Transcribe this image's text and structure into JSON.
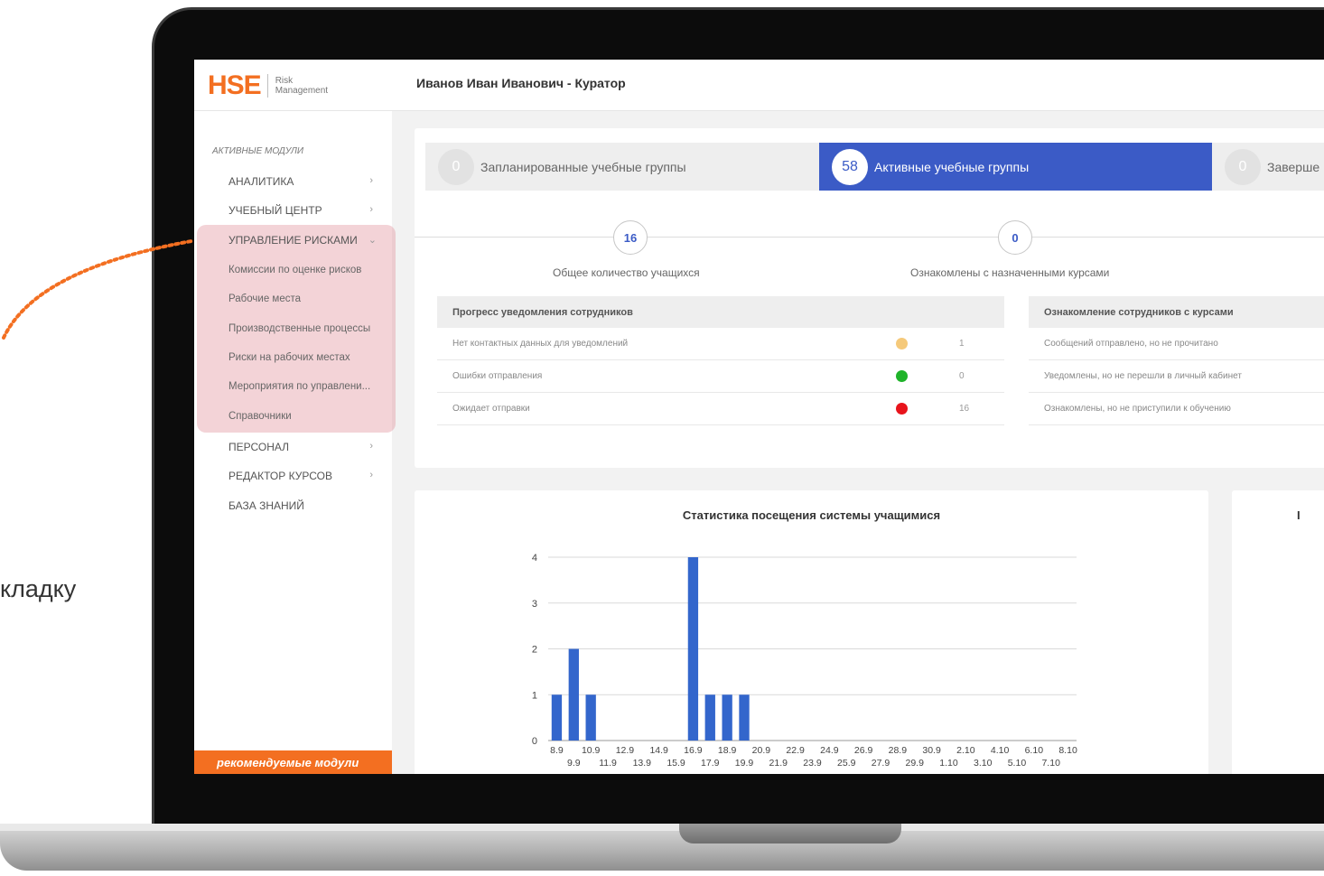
{
  "header": {
    "logo_main": "HSE",
    "logo_sub_line1": "Risk",
    "logo_sub_line2": "Management",
    "user_title": "Иванов Иван Иванович - Куратор"
  },
  "sidebar": {
    "caption": "АКТИВНЫЕ МОДУЛИ",
    "items": [
      {
        "label": "АНАЛИТИКА",
        "chevron": "›"
      },
      {
        "label": "УЧЕБНЫЙ ЦЕНТР",
        "chevron": "›"
      },
      {
        "label": "УПРАВЛЕНИЕ РИСКАМИ",
        "chevron": "⌄"
      },
      {
        "label": "ПЕРСОНАЛ",
        "chevron": "›"
      },
      {
        "label": "РЕДАКТОР КУРСОВ",
        "chevron": "›"
      },
      {
        "label": "БАЗА ЗНАНИЙ",
        "chevron": ""
      }
    ],
    "subitems": [
      "Комиссии по оценке рисков",
      "Рабочие места",
      "Производственные процессы",
      "Риски на рабочих местах",
      "Мероприятия по управлени...",
      "Справочники"
    ],
    "recommended": "рекомендуемые модули"
  },
  "tabs": [
    {
      "count": "0",
      "label": "Запланированные учебные группы"
    },
    {
      "count": "58",
      "label": "Активные учебные группы"
    },
    {
      "count": "0",
      "label": "Заверше"
    }
  ],
  "stats": [
    {
      "value": "16",
      "label": "Общее количество учащихся"
    },
    {
      "value": "0",
      "label": "Ознакомлены с назначенными курсами"
    }
  ],
  "table_left": {
    "header": "Прогресс уведомления сотрудников",
    "rows": [
      {
        "label": "Нет контактных данных для уведомлений",
        "value": "1",
        "status_color": "#f5c97a"
      },
      {
        "label": "Ошибки отправления",
        "value": "0",
        "status_color": "#1fb32a"
      },
      {
        "label": "Ожидает отправки",
        "value": "16",
        "status_color": "#e8141c"
      }
    ]
  },
  "table_right": {
    "header": "Ознакомление сотрудников с курсами",
    "rows": [
      "Сообщений отправлено, но не прочитано",
      "Уведомлены, но не перешли в личный кабинет",
      "Ознакомлены, но не приступили к обучению"
    ]
  },
  "chart_panel_title": "Статистика посещения системы учащимися",
  "right_panel_title": "I",
  "chart_data": {
    "type": "bar",
    "ylim": [
      0,
      4
    ],
    "yticks": [
      "0",
      "1",
      "2",
      "3",
      "4"
    ],
    "categories": [
      "8.9",
      "9.9",
      "10.9",
      "11.9",
      "12.9",
      "13.9",
      "14.9",
      "15.9",
      "16.9",
      "17.9",
      "18.9",
      "19.9",
      "20.9",
      "21.9",
      "22.9",
      "23.9",
      "24.9",
      "25.9",
      "26.9",
      "27.9",
      "28.9",
      "29.9",
      "30.9",
      "1.10",
      "2.10",
      "3.10",
      "4.10",
      "5.10",
      "6.10",
      "7.10",
      "8.10"
    ],
    "values": [
      1,
      2,
      1,
      0,
      0,
      0,
      0,
      0,
      4,
      1,
      1,
      1,
      0,
      0,
      0,
      0,
      0,
      0,
      0,
      0,
      0,
      0,
      0,
      0,
      0,
      0,
      0,
      0,
      0,
      0,
      0
    ],
    "bar_color": "#3366cc",
    "xlabel": "",
    "ylabel": ""
  },
  "outside_text": "кладку",
  "colors": {
    "accent": "#3b5bc6",
    "brand": "#f36f21",
    "highlight": "#e296a0"
  }
}
